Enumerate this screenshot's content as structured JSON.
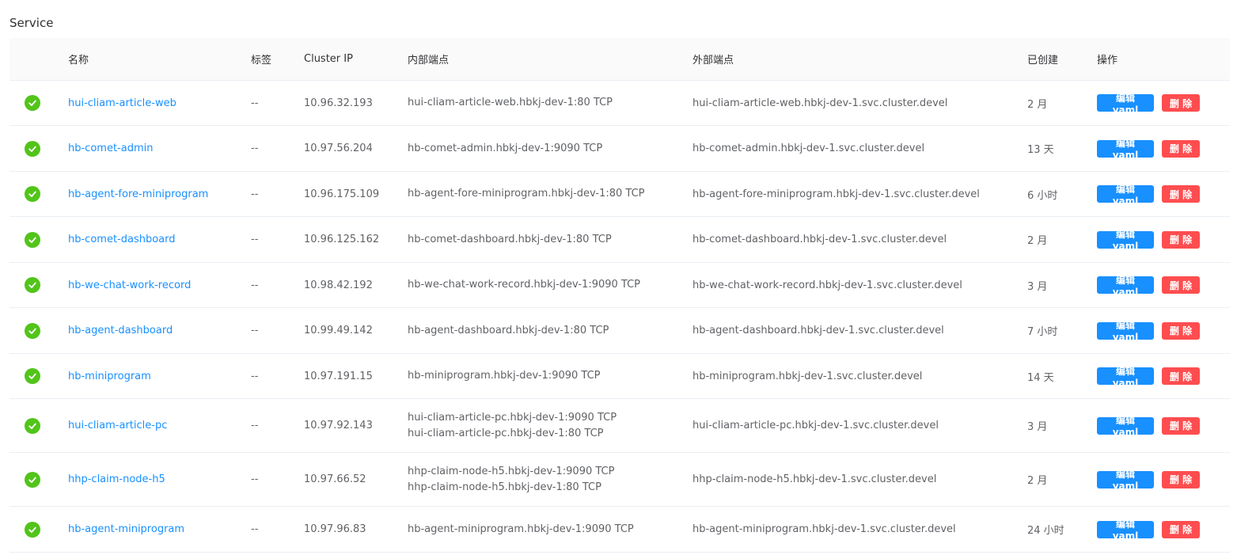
{
  "section": {
    "title": "Service"
  },
  "columns": {
    "name": "名称",
    "tags": "标签",
    "cluster_ip": "Cluster IP",
    "internal": "内部端点",
    "external": "外部端点",
    "created": "已创建",
    "actions": "操作"
  },
  "actions": {
    "edit": "编辑yaml",
    "delete": "删 除"
  },
  "colors": {
    "status_ok": "#52c41a",
    "link": "#1890ff",
    "edit_btn": "#1890ff",
    "delete_btn": "#ff4d4f"
  },
  "rows": [
    {
      "name": "hui-cliam-article-web",
      "tags": "--",
      "ip": "10.96.32.193",
      "internal": [
        "hui-cliam-article-web.hbkj-dev-1:80 TCP"
      ],
      "external": "hui-cliam-article-web.hbkj-dev-1.svc.cluster.devel",
      "created": "2 月"
    },
    {
      "name": "hb-comet-admin",
      "tags": "--",
      "ip": "10.97.56.204",
      "internal": [
        "hb-comet-admin.hbkj-dev-1:9090 TCP"
      ],
      "external": "hb-comet-admin.hbkj-dev-1.svc.cluster.devel",
      "created": "13 天"
    },
    {
      "name": "hb-agent-fore-miniprogram",
      "tags": "--",
      "ip": "10.96.175.109",
      "internal": [
        "hb-agent-fore-miniprogram.hbkj-dev-1:80 TCP"
      ],
      "external": "hb-agent-fore-miniprogram.hbkj-dev-1.svc.cluster.devel",
      "created": "6 小时"
    },
    {
      "name": "hb-comet-dashboard",
      "tags": "--",
      "ip": "10.96.125.162",
      "internal": [
        "hb-comet-dashboard.hbkj-dev-1:80 TCP"
      ],
      "external": "hb-comet-dashboard.hbkj-dev-1.svc.cluster.devel",
      "created": "2 月"
    },
    {
      "name": "hb-we-chat-work-record",
      "tags": "--",
      "ip": "10.98.42.192",
      "internal": [
        "hb-we-chat-work-record.hbkj-dev-1:9090 TCP"
      ],
      "external": "hb-we-chat-work-record.hbkj-dev-1.svc.cluster.devel",
      "created": "3 月"
    },
    {
      "name": "hb-agent-dashboard",
      "tags": "--",
      "ip": "10.99.49.142",
      "internal": [
        "hb-agent-dashboard.hbkj-dev-1:80 TCP"
      ],
      "external": "hb-agent-dashboard.hbkj-dev-1.svc.cluster.devel",
      "created": "7 小时"
    },
    {
      "name": "hb-miniprogram",
      "tags": "--",
      "ip": "10.97.191.15",
      "internal": [
        "hb-miniprogram.hbkj-dev-1:9090 TCP"
      ],
      "external": "hb-miniprogram.hbkj-dev-1.svc.cluster.devel",
      "created": "14 天"
    },
    {
      "name": "hui-cliam-article-pc",
      "tags": "--",
      "ip": "10.97.92.143",
      "internal": [
        "hui-cliam-article-pc.hbkj-dev-1:9090 TCP",
        "hui-cliam-article-pc.hbkj-dev-1:80 TCP"
      ],
      "external": "hui-cliam-article-pc.hbkj-dev-1.svc.cluster.devel",
      "created": "3 月"
    },
    {
      "name": "hhp-claim-node-h5",
      "tags": "--",
      "ip": "10.97.66.52",
      "internal": [
        "hhp-claim-node-h5.hbkj-dev-1:9090 TCP",
        "hhp-claim-node-h5.hbkj-dev-1:80 TCP"
      ],
      "external": "hhp-claim-node-h5.hbkj-dev-1.svc.cluster.devel",
      "created": "2 月"
    },
    {
      "name": "hb-agent-miniprogram",
      "tags": "--",
      "ip": "10.97.96.83",
      "internal": [
        "hb-agent-miniprogram.hbkj-dev-1:9090 TCP"
      ],
      "external": "hb-agent-miniprogram.hbkj-dev-1.svc.cluster.devel",
      "created": "24 小时"
    }
  ]
}
